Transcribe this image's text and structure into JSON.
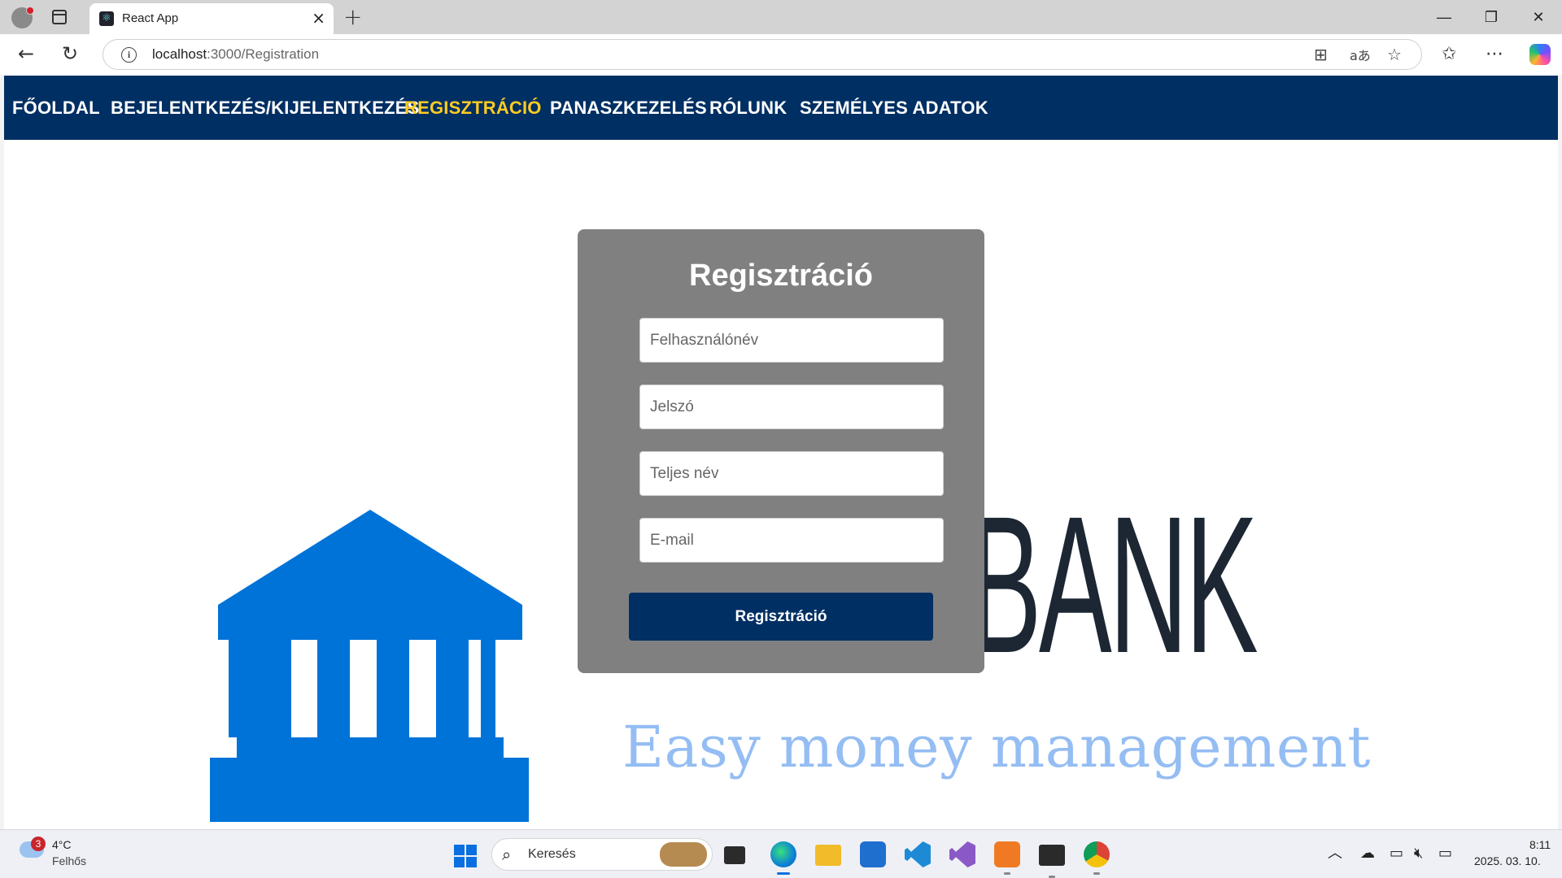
{
  "browser": {
    "tab_title": "React App",
    "tab_favicon": "react-icon",
    "url_host": "localhost",
    "url_rest": ":3000/Registration",
    "window_controls": {
      "minimize": "—",
      "restore": "❐",
      "close": "✕"
    }
  },
  "nav": {
    "items": [
      {
        "label": "FŐOLDAL",
        "active": false
      },
      {
        "label": "BEJELENTKEZÉS/KIJELENTKEZÉS",
        "active": false
      },
      {
        "label": "REGISZTRÁCIÓ",
        "active": true
      },
      {
        "label": "PANASZKEZELÉS",
        "active": false
      },
      {
        "label": "RÓLUNK",
        "active": false
      },
      {
        "label": "SZEMÉLYES ADATOK",
        "active": false
      }
    ],
    "background": "#002f63",
    "active_color": "#ffcc22"
  },
  "hero": {
    "brand": "MAMIKBANK",
    "tagline": "Easy money management",
    "logo_icon": "bank-building-icon",
    "logo_color": "#0073d9"
  },
  "registration": {
    "title": "Regisztráció",
    "fields": {
      "username_placeholder": "Felhasználónév",
      "password_placeholder": "Jelszó",
      "fullname_placeholder": "Teljes név",
      "email_placeholder": "E-mail"
    },
    "submit_label": "Regisztráció",
    "card_color": "#808080",
    "button_color": "#002f63"
  },
  "taskbar": {
    "weather_badge": "3",
    "weather_temp": "4°C",
    "weather_desc": "Felhős",
    "search_placeholder": "Keresés",
    "time": "8:11",
    "date": "2025. 03. 10."
  }
}
